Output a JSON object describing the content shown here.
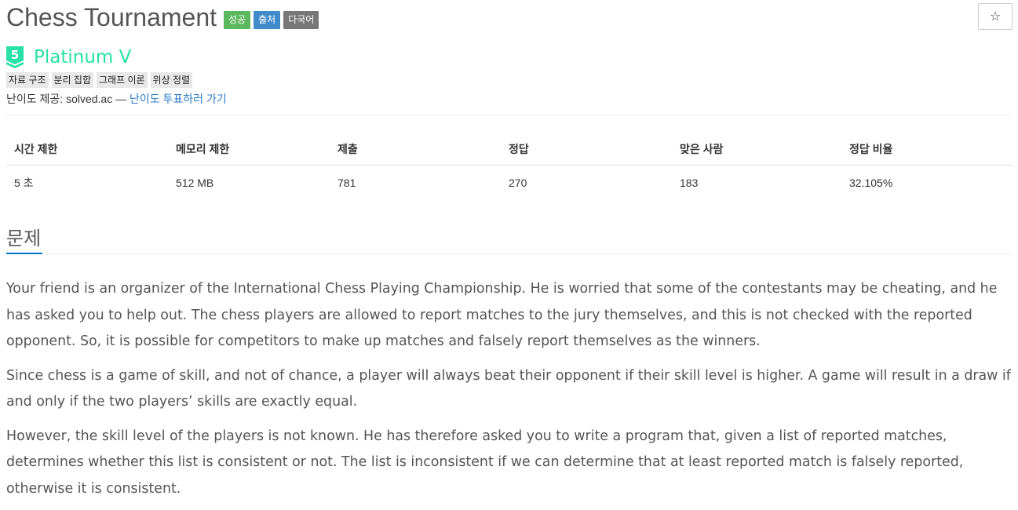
{
  "header": {
    "title": "Chess Tournament",
    "badges": [
      {
        "label": "성공",
        "color": "#5cb85c"
      },
      {
        "label": "출처",
        "color": "#428bca"
      },
      {
        "label": "다국어",
        "color": "#777777"
      }
    ],
    "star_icon": "☆"
  },
  "tier": {
    "number": "5",
    "name": "Platinum V",
    "color": "#27e2a4"
  },
  "tags": [
    "자료 구조",
    "분리 집합",
    "그래프 이론",
    "위상 정렬"
  ],
  "provider": {
    "text": "난이도 제공: solved.ac — ",
    "link": "난이도 투표하러 가기"
  },
  "stats": {
    "headers": [
      "시간 제한",
      "메모리 제한",
      "제출",
      "정답",
      "맞은 사람",
      "정답 비율"
    ],
    "values": [
      "5 초",
      "512 MB",
      "781",
      "270",
      "183",
      "32.105%"
    ]
  },
  "section": {
    "title": "문제"
  },
  "problem": {
    "paragraphs": [
      "Your friend is an organizer of the International Chess Playing Championship. He is worried that some of the contestants may be cheating, and he has asked you to help out. The chess players are allowed to report matches to the jury themselves, and this is not checked with the reported opponent. So, it is possible for competitors to make up matches and falsely report themselves as the winners.",
      "Since chess is a game of skill, and not of chance, a player will always beat their opponent if their skill level is higher. A game will result in a draw if and only if the two players’ skills are exactly equal.",
      "However, the skill level of the players is not known. He has therefore asked you to write a program that, given a list of reported matches, determines whether this list is consistent or not. The list is inconsistent if we can determine that at least reported match is falsely reported, otherwise it is consistent."
    ]
  }
}
